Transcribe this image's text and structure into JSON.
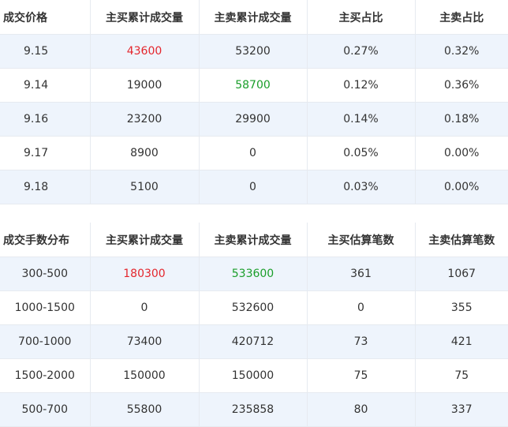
{
  "price_table": {
    "headers": [
      "成交价格",
      "主买累计成交量",
      "主卖累计成交量",
      "主买占比",
      "主卖占比"
    ],
    "rows": [
      {
        "price": "9.15",
        "buy_vol": "43600",
        "sell_vol": "53200",
        "buy_pct": "0.27%",
        "sell_pct": "0.32%",
        "highlight": "buy_vol"
      },
      {
        "price": "9.14",
        "buy_vol": "19000",
        "sell_vol": "58700",
        "buy_pct": "0.12%",
        "sell_pct": "0.36%",
        "highlight": "sell_vol"
      },
      {
        "price": "9.16",
        "buy_vol": "23200",
        "sell_vol": "29900",
        "buy_pct": "0.14%",
        "sell_pct": "0.18%",
        "highlight": ""
      },
      {
        "price": "9.17",
        "buy_vol": "8900",
        "sell_vol": "0",
        "buy_pct": "0.05%",
        "sell_pct": "0.00%",
        "highlight": ""
      },
      {
        "price": "9.18",
        "buy_vol": "5100",
        "sell_vol": "0",
        "buy_pct": "0.03%",
        "sell_pct": "0.00%",
        "highlight": ""
      }
    ]
  },
  "dist_table": {
    "headers": [
      "成交手数分布",
      "主买累计成交量",
      "主卖累计成交量",
      "主买估算笔数",
      "主卖估算笔数"
    ],
    "rows": [
      {
        "range": "300-500",
        "buy_vol": "180300",
        "sell_vol": "533600",
        "buy_cnt": "361",
        "sell_cnt": "1067",
        "red": true,
        "green": true
      },
      {
        "range": "1000-1500",
        "buy_vol": "0",
        "sell_vol": "532600",
        "buy_cnt": "0",
        "sell_cnt": "355",
        "red": false,
        "green": false
      },
      {
        "range": "700-1000",
        "buy_vol": "73400",
        "sell_vol": "420712",
        "buy_cnt": "73",
        "sell_cnt": "421",
        "red": false,
        "green": false
      },
      {
        "range": "1500-2000",
        "buy_vol": "150000",
        "sell_vol": "150000",
        "buy_cnt": "75",
        "sell_cnt": "75",
        "red": false,
        "green": false
      },
      {
        "range": "500-700",
        "buy_vol": "55800",
        "sell_vol": "235858",
        "buy_cnt": "80",
        "sell_cnt": "337",
        "red": false,
        "green": false
      }
    ]
  },
  "colors": {
    "stripe": "#eef4fc",
    "red": "#e4262d",
    "green": "#1a9e2a",
    "border": "#e6eaf0"
  }
}
